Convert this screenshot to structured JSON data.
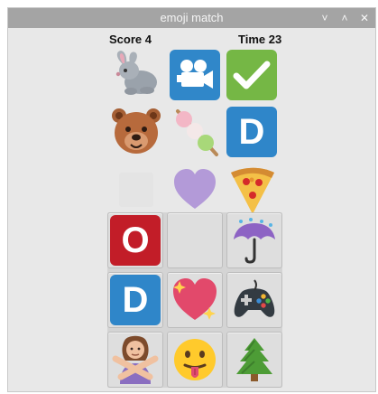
{
  "window": {
    "title": "emoji match",
    "controls": [
      "˅",
      "˄",
      "✕"
    ]
  },
  "status": {
    "score_label": "Score",
    "score_value": "4",
    "time_label": "Time",
    "time_value": "23"
  },
  "upper_emojis": [
    {
      "name": "rabbit",
      "icon": "rabbit-icon"
    },
    {
      "name": "movie camera",
      "icon": "movie-camera-icon",
      "color": "#3087c9"
    },
    {
      "name": "check mark button",
      "icon": "check-mark-icon",
      "color": "#75b745"
    },
    {
      "name": "bear",
      "icon": "bear-icon"
    },
    {
      "name": "dango",
      "icon": "dango-icon"
    },
    {
      "name": "D letter tile",
      "label": "D",
      "color": "#2f86c9"
    },
    {
      "name": "blank square",
      "icon": "square-icon"
    },
    {
      "name": "purple heart",
      "icon": "purple-heart-icon",
      "color": "#b39ad8"
    },
    {
      "name": "pizza",
      "icon": "pizza-icon"
    }
  ],
  "board_tiles": [
    {
      "name": "O letter tile",
      "label": "O",
      "color": "#c21d28"
    },
    {
      "name": "empty slot",
      "icon": "empty-slot"
    },
    {
      "name": "umbrella with rain",
      "icon": "umbrella-rain-icon"
    },
    {
      "name": "D letter tile",
      "label": "D",
      "color": "#2f86c9"
    },
    {
      "name": "sparkling heart",
      "icon": "sparkling-heart-icon"
    },
    {
      "name": "game controller",
      "icon": "game-controller-icon"
    },
    {
      "name": "person gesturing no",
      "icon": "person-gesturing-no-icon"
    },
    {
      "name": "face with tongue",
      "icon": "face-with-tongue-icon"
    },
    {
      "name": "evergreen tree",
      "icon": "evergreen-tree-icon"
    }
  ]
}
